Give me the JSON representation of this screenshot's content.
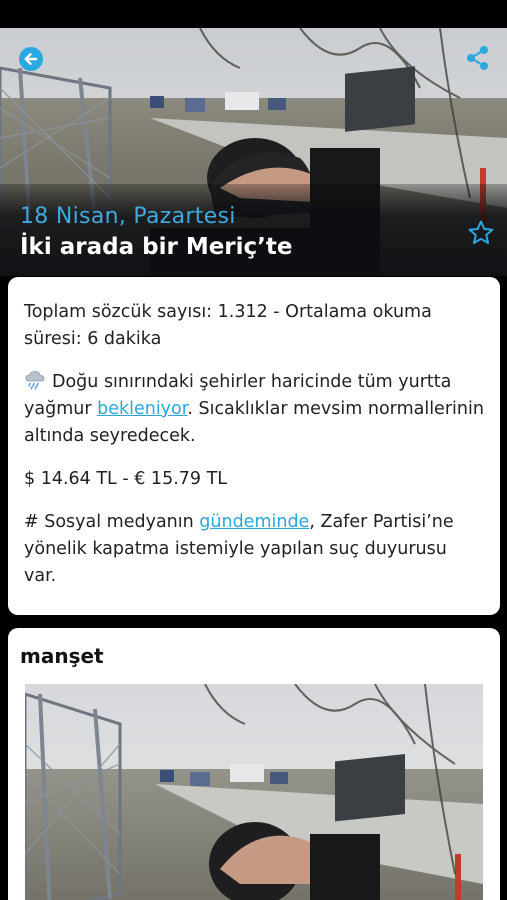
{
  "hero": {
    "date": "18 Nisan, Pazartesi",
    "title": "İki arada bir Meriç’te"
  },
  "icons": {
    "back": "arrow-left-circle-icon",
    "share": "share-icon",
    "bookmark": "star-outline-icon",
    "weather": "rain-cloud-icon"
  },
  "colors": {
    "accent": "#29a8dc",
    "date": "#3fa9e0"
  },
  "summary": {
    "word_count": "Toplam sözcük sayısı: 1.312  - Ortalama okuma süresi: 6 dakika",
    "weather_before": "Doğu sınırındaki şehirler haricinde tüm yurtta yağmur ",
    "weather_link": "bekleniyor",
    "weather_after": ". Sıcaklıklar mevsim normallerinin altında seyredecek.",
    "currency": "$ 14.64 TL - € 15.79 TL",
    "social_before": "# Sosyal medyanın ",
    "social_link": "gündeminde",
    "social_after": ", Zafer Partisi’ne yönelik kapatma istemiyle yapılan suç duyurusu var."
  },
  "manset": {
    "title": "manşet"
  }
}
